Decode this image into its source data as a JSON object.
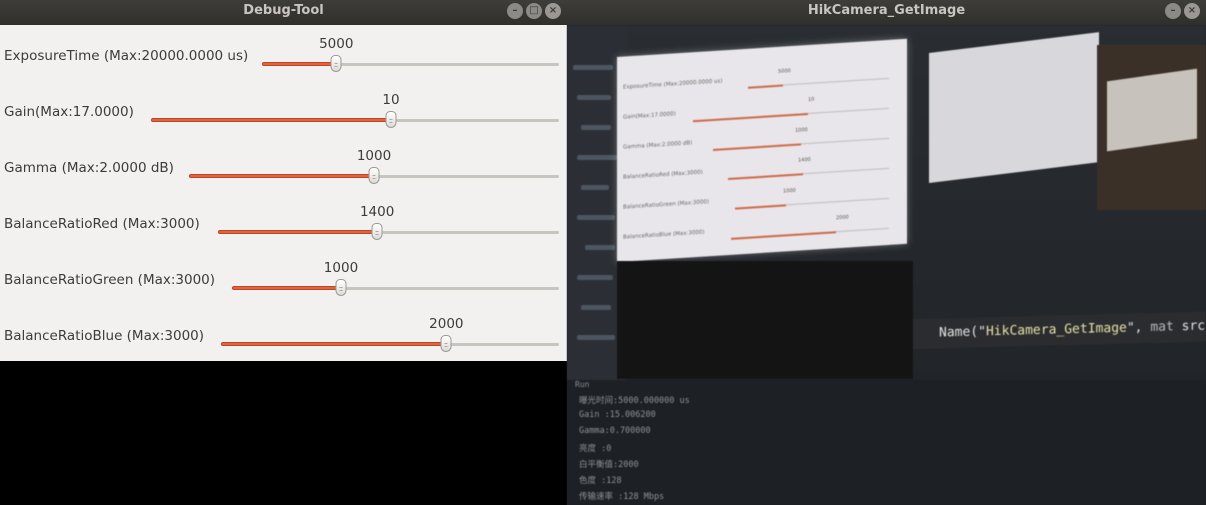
{
  "debug_window": {
    "title": "Debug-Tool",
    "sliders": [
      {
        "label": "ExposureTime (Max:20000.0000 us)",
        "value": "5000",
        "fraction": 0.25
      },
      {
        "label": "Gain(Max:17.0000)",
        "value": "10",
        "fraction": 0.5882
      },
      {
        "label": "Gamma (Max:2.0000 dB)",
        "value": "1000",
        "fraction": 0.5
      },
      {
        "label": "BalanceRatioRed (Max:3000)",
        "value": "1400",
        "fraction": 0.4667
      },
      {
        "label": "BalanceRatioGreen (Max:3000)",
        "value": "1000",
        "fraction": 0.3333
      },
      {
        "label": "BalanceRatioBlue (Max:3000)",
        "value": "2000",
        "fraction": 0.6667
      }
    ]
  },
  "camera_window": {
    "title": "HikCamera_GetImage",
    "captured_code": {
      "prefix": "Name(\"",
      "string": "HikCamera_GetImage",
      "suffix": "\", ",
      "keyword": "mat",
      "arg": "src);"
    },
    "terminal_tab": "Run",
    "terminal_lines": [
      "曝光时间:5000.000000 us",
      "Gain :15.006200",
      "Gamma:0.700000",
      "亮度 :0",
      "白平衡值:2000",
      "色度 :128",
      "传输速率 :128 Mbps"
    ]
  },
  "colors": {
    "slider_fill": "#e8613a",
    "panel_bg": "#f2f1f0",
    "titlebar": "#3a3935"
  },
  "icons": [
    "minimize-icon",
    "maximize-icon",
    "close-icon"
  ]
}
